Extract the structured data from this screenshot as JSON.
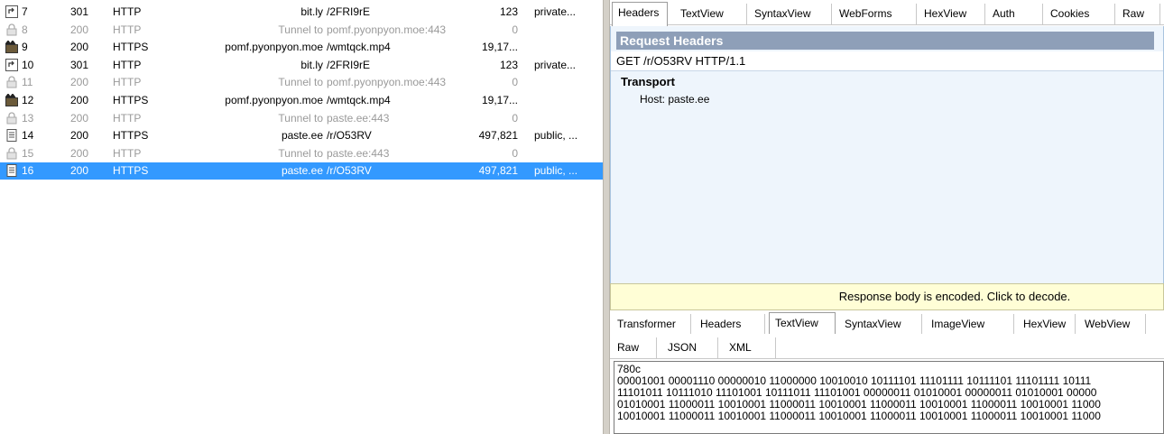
{
  "sessions": [
    {
      "num": "7",
      "result": "301",
      "protocol": "HTTP",
      "host": "bit.ly",
      "url": "/2FRI9rE",
      "body": "123",
      "caching": "private...",
      "icon": "redirect-icon",
      "state": "normal"
    },
    {
      "num": "8",
      "result": "200",
      "protocol": "HTTP",
      "host": "Tunnel to",
      "url": "pomf.pyonpyon.moe:443",
      "body": "0",
      "caching": "",
      "icon": "lock-icon",
      "state": "tunnel"
    },
    {
      "num": "9",
      "result": "200",
      "protocol": "HTTPS",
      "host": "pomf.pyonpyon.moe",
      "url": "/wmtqck.mp4",
      "body": "19,17...",
      "caching": "",
      "icon": "video-icon",
      "state": "normal"
    },
    {
      "num": "10",
      "result": "301",
      "protocol": "HTTP",
      "host": "bit.ly",
      "url": "/2FRI9rE",
      "body": "123",
      "caching": "private...",
      "icon": "redirect-icon",
      "state": "normal"
    },
    {
      "num": "11",
      "result": "200",
      "protocol": "HTTP",
      "host": "Tunnel to",
      "url": "pomf.pyonpyon.moe:443",
      "body": "0",
      "caching": "",
      "icon": "lock-icon",
      "state": "tunnel"
    },
    {
      "num": "12",
      "result": "200",
      "protocol": "HTTPS",
      "host": "pomf.pyonpyon.moe",
      "url": "/wmtqck.mp4",
      "body": "19,17...",
      "caching": "",
      "icon": "video-icon",
      "state": "normal"
    },
    {
      "num": "13",
      "result": "200",
      "protocol": "HTTP",
      "host": "Tunnel to",
      "url": "paste.ee:443",
      "body": "0",
      "caching": "",
      "icon": "lock-icon",
      "state": "tunnel"
    },
    {
      "num": "14",
      "result": "200",
      "protocol": "HTTPS",
      "host": "paste.ee",
      "url": "/r/O53RV",
      "body": "497,821",
      "caching": "public, ...",
      "icon": "document-icon",
      "state": "normal"
    },
    {
      "num": "15",
      "result": "200",
      "protocol": "HTTP",
      "host": "Tunnel to",
      "url": "paste.ee:443",
      "body": "0",
      "caching": "",
      "icon": "lock-icon",
      "state": "tunnel"
    },
    {
      "num": "16",
      "result": "200",
      "protocol": "HTTPS",
      "host": "paste.ee",
      "url": "/r/O53RV",
      "body": "497,821",
      "caching": "public, ...",
      "icon": "document-icon",
      "state": "selected"
    }
  ],
  "request_tabs": [
    "Headers",
    "TextView",
    "SyntaxView",
    "WebForms",
    "HexView",
    "Auth",
    "Cookies",
    "Raw"
  ],
  "request_active_tab": "Headers",
  "request": {
    "heading": "Request Headers",
    "request_line": "GET /r/O53RV HTTP/1.1",
    "group": "Transport",
    "host_header": "Host: paste.ee"
  },
  "notice": "Response body is encoded. Click to decode.",
  "response_tabs": [
    "Transformer",
    "Headers",
    "TextView",
    "SyntaxView",
    "ImageView",
    "HexView",
    "WebView"
  ],
  "response_active_tab": "TextView",
  "response_tabs_row2": [
    "Raw",
    "JSON",
    "XML"
  ],
  "response_body": "780c\n00001001 00001110 00000010 11000000 10010010 10111101 11101111 10111101 11101111 10111\n11101011 10111010 11101001 10111011 11101001 00000011 01010001 00000011 01010001 00000\n01010001 11000011 10010001 11000011 10010001 11000011 10010001 11000011 10010001 11000\n10010001 11000011 10010001 11000011 10010001 11000011 10010001 11000011 10010001 11000",
  "colors": {
    "selection": "#3399ff",
    "tunnel_text": "#9a9a9a",
    "panel_bg": "#eef5fc",
    "heading_bg": "#8e9fb8",
    "notice_bg": "#fffed6"
  }
}
